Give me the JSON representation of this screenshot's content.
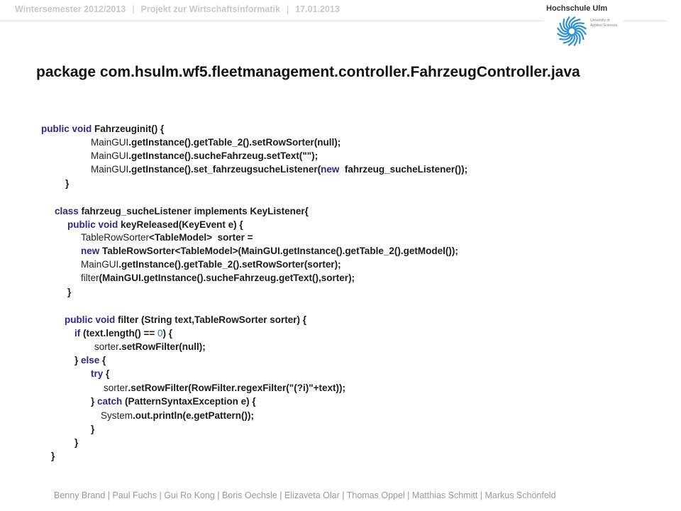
{
  "header": {
    "semester": "Wintersemester 2012/2013",
    "project": "Projekt zur Wirtschaftsinformatik",
    "date": "17.01.2013",
    "separator": "|"
  },
  "logo": {
    "name": "Hochschule Ulm",
    "subtitle": "University of Applied Sciences",
    "icon": "spiral-logo-icon",
    "color": "#2a8fd0"
  },
  "title": "package com.hsulm.wf5.fleetmanagement.controller.FahrzeugController.java",
  "code": {
    "l01": {
      "kw": "public void",
      "rest": " Fahrzeuginit() {"
    },
    "l02": {
      "plain": "MainGUI",
      "rest": ".getInstance().getTable_2().setRowSorter(null);"
    },
    "l03": {
      "plain": "MainGUI",
      "rest": ".getInstance().sucheFahrzeug.setText(\"\");"
    },
    "l04": {
      "plain": "MainGUI",
      "rest": ".getInstance().set_fahrzeugsucheListener(",
      "kw": "new",
      "rest2": "  fahrzeug_sucheListener());"
    },
    "l05": {
      "rest": "}"
    },
    "l06": {
      "kw": "class",
      "rest": " fahrzeug_sucheListener implements KeyListener{"
    },
    "l07": {
      "kw": "public void",
      "rest": " keyReleased(KeyEvent e) {"
    },
    "l08": {
      "plain": "TableRowSorter",
      "rest": "<TableModel>  sorter ="
    },
    "l09": {
      "kw": "new",
      "rest": " TableRowSorter<TableModel>(MainGUI.getInstance().getTable_2().getModel());"
    },
    "l10": {
      "plain": "MainGUI",
      "rest": ".getInstance().getTable_2().setRowSorter(sorter);"
    },
    "l11": {
      "plain": "filter",
      "rest": "(MainGUI.getInstance().sucheFahrzeug.getText(),sorter);"
    },
    "l12": {
      "rest": "}"
    },
    "l13": {
      "kw": "public void",
      "rest": " filter (String text,TableRowSorter sorter) {"
    },
    "l14": {
      "kw": "if",
      "rest": " (text.length() == ",
      "lit": "0",
      "rest2": ") {"
    },
    "l15": {
      "plain": "sorter",
      "rest": ".setRowFilter(null);"
    },
    "l16": {
      "rest": "} ",
      "kw": "else",
      "rest2": " {"
    },
    "l17": {
      "kw": "try",
      "rest": " {"
    },
    "l18": {
      "plain": "sorter",
      "rest": ".setRowFilter(RowFilter.regexFilter(\"(?i)\"+text));"
    },
    "l19": {
      "rest": "} ",
      "kw": "catch",
      "rest2": " (PatternSyntaxException e) {"
    },
    "l20": {
      "plain": "System",
      "rest": ".out.println(e.getPattern());"
    },
    "l21": {
      "rest": "}"
    },
    "l22": {
      "rest": "}"
    },
    "l23": {
      "rest": "}"
    }
  },
  "footer": "Benny Brand | Paul Fuchs | Gui Ro Kong | Boris Oechsle | Elizaveta Olar | Thomas Oppel | Matthias Schmitt | Markus Schönfeld"
}
